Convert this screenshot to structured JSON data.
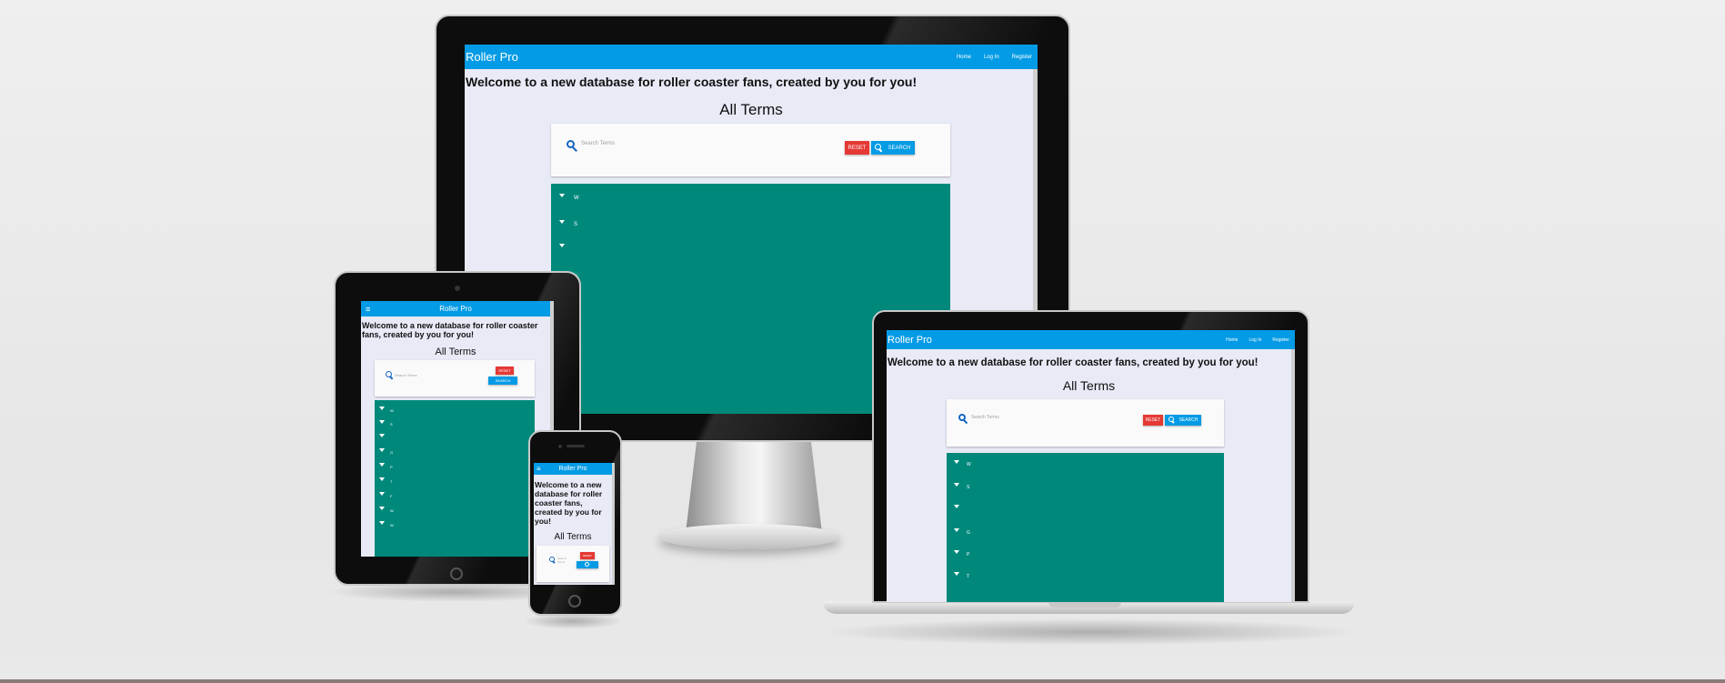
{
  "app": {
    "brand": "Roller Pro"
  },
  "nav": {
    "home": "Home",
    "login": "Log In",
    "register": "Register"
  },
  "main": {
    "welcome": "Welcome to a new database for roller coaster fans, created by you for you!",
    "terms_title": "All Terms"
  },
  "search": {
    "placeholder": "Search Terms",
    "reset_label": "RESET",
    "search_label": "SEARCH"
  },
  "terms": {
    "desktop": [
      "W",
      "S",
      ""
    ],
    "tablet": [
      "W",
      "S",
      "",
      "G",
      "P",
      "T",
      "F",
      "W",
      "W"
    ],
    "laptop": [
      "W",
      "S",
      "",
      "G",
      "P",
      "T"
    ]
  },
  "colors": {
    "nav": "#039be5",
    "list_bg": "#00897b",
    "reset": "#e53935",
    "search": "#039be5",
    "page_bg": "#e8eaf6"
  },
  "icons": {
    "search": "search-icon",
    "menu": "menu-icon",
    "expand": "caret-down-icon"
  }
}
